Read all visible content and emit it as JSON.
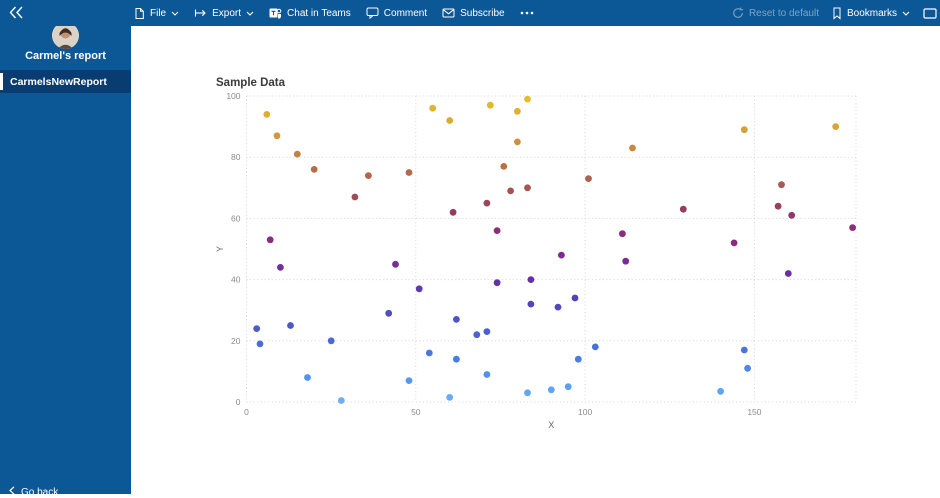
{
  "app": {
    "topbar_color": "#0C5796",
    "sidebar_selected_color": "#093D72",
    "canvas_color": "#FFFFFF"
  },
  "toolbar": {
    "items": [
      {
        "label": "File",
        "icon": "file-icon",
        "chevron": true
      },
      {
        "label": "Export",
        "icon": "export-icon",
        "chevron": true
      },
      {
        "label": "Chat in Teams",
        "icon": "teams-icon",
        "chevron": false
      },
      {
        "label": "Comment",
        "icon": "comment-icon",
        "chevron": false
      },
      {
        "label": "Subscribe",
        "icon": "subscribe-icon",
        "chevron": false
      },
      {
        "label": "",
        "icon": "more-icon",
        "chevron": false
      }
    ],
    "right_items": [
      {
        "label": "Reset to default",
        "icon": "reset-icon",
        "disabled": true
      },
      {
        "label": "Bookmarks",
        "icon": "bookmark-icon",
        "chevron": true
      }
    ]
  },
  "sidebar": {
    "report_title": "Carmel's report",
    "nav_items": [
      {
        "label": "CarmelsNewReport",
        "selected": true
      }
    ],
    "footer_label": "Go back"
  },
  "chart_data": {
    "type": "scatter",
    "title": "Sample Data",
    "xlabel": "X",
    "ylabel": "Y",
    "xlim": [
      0,
      180
    ],
    "ylim": [
      0,
      100
    ],
    "xticks": [
      0,
      50,
      100,
      150
    ],
    "yticks": [
      0,
      20,
      40,
      60,
      80,
      100
    ],
    "grid": "dotted",
    "legend": "none",
    "point_color_encodes": "y-value",
    "colormap": [
      [
        0,
        "#70B1F7"
      ],
      [
        6,
        "#559DEF"
      ],
      [
        12,
        "#4A84E4"
      ],
      [
        18,
        "#4A6FD9"
      ],
      [
        25,
        "#4D58CB"
      ],
      [
        32,
        "#5346BD"
      ],
      [
        39,
        "#6232A8"
      ],
      [
        46,
        "#782C98"
      ],
      [
        52,
        "#862C87"
      ],
      [
        58,
        "#8C3172"
      ],
      [
        64,
        "#97415B"
      ],
      [
        70,
        "#A75650"
      ],
      [
        77,
        "#BA7047"
      ],
      [
        84,
        "#CC8C3D"
      ],
      [
        90,
        "#D8A434"
      ],
      [
        95,
        "#DFB22E"
      ],
      [
        100,
        "#E5BE2B"
      ]
    ],
    "points": [
      [
        6,
        94
      ],
      [
        9,
        87
      ],
      [
        15,
        81
      ],
      [
        20,
        76
      ],
      [
        36,
        74
      ],
      [
        32,
        67
      ],
      [
        48,
        75
      ],
      [
        7,
        53
      ],
      [
        10,
        44
      ],
      [
        3,
        24
      ],
      [
        13,
        25
      ],
      [
        4,
        19
      ],
      [
        25,
        20
      ],
      [
        18,
        8
      ],
      [
        28,
        0.5
      ],
      [
        55,
        96
      ],
      [
        60,
        92
      ],
      [
        72,
        97
      ],
      [
        83,
        99
      ],
      [
        80,
        95
      ],
      [
        80,
        85
      ],
      [
        76,
        77
      ],
      [
        83,
        70
      ],
      [
        78,
        69
      ],
      [
        71,
        65
      ],
      [
        61,
        62
      ],
      [
        74,
        56
      ],
      [
        44,
        45
      ],
      [
        51,
        37
      ],
      [
        42,
        29
      ],
      [
        48,
        7
      ],
      [
        54,
        16
      ],
      [
        62,
        14
      ],
      [
        62,
        27
      ],
      [
        68,
        22
      ],
      [
        71,
        23
      ],
      [
        74,
        39
      ],
      [
        71,
        9
      ],
      [
        60,
        1.5
      ],
      [
        84,
        40
      ],
      [
        84,
        32
      ],
      [
        83,
        3
      ],
      [
        90,
        4
      ],
      [
        147,
        89
      ],
      [
        174,
        90
      ],
      [
        114,
        83
      ],
      [
        101,
        73
      ],
      [
        158,
        71
      ],
      [
        129,
        63
      ],
      [
        157,
        64
      ],
      [
        161,
        61
      ],
      [
        111,
        55
      ],
      [
        144,
        52
      ],
      [
        179,
        57
      ],
      [
        93,
        48
      ],
      [
        112,
        46
      ],
      [
        160,
        42
      ],
      [
        97,
        34
      ],
      [
        92,
        31
      ],
      [
        103,
        18
      ],
      [
        98,
        14
      ],
      [
        95,
        5
      ],
      [
        140,
        3.5
      ],
      [
        147,
        17
      ],
      [
        148,
        11
      ]
    ]
  }
}
